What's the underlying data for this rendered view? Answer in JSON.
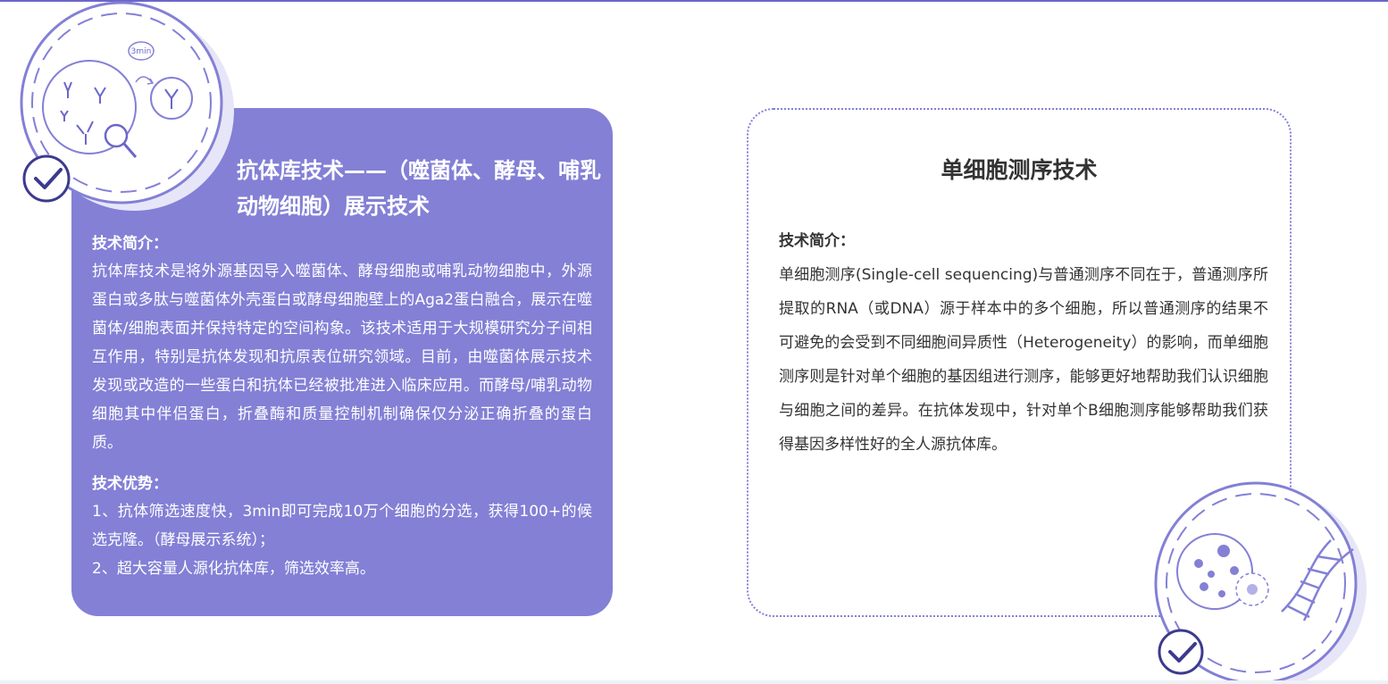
{
  "left_card": {
    "title": "抗体库技术——（噬菌体、酵母、哺乳动物细胞）展示技术",
    "intro_heading": "技术简介：",
    "intro_text": "抗体库技术是将外源基因导入噬菌体、酵母细胞或哺乳动物细胞中，外源蛋白或多肽与噬菌体外壳蛋白或酵母细胞壁上的Aga2蛋白融合，展示在噬菌体/细胞表面并保持特定的空间构象。该技术适用于大规模研究分子间相互作用，特别是抗体发现和抗原表位研究领域。目前，由噬菌体展示技术发现或改造的一些蛋白和抗体已经被批准进入临床应用。而酵母/哺乳动物细胞其中伴侣蛋白，折叠酶和质量控制机制确保仅分泌正确折叠的蛋白质。",
    "advantage_heading": "技术优势：",
    "advantage_1": "1、抗体筛选速度快，3min即可完成10万个细胞的分选，获得100+的候选克隆。（酵母展示系统）；",
    "advantage_2": "2、超大容量人源化抗体库，筛选效率高。",
    "icon_badge_text": "3min"
  },
  "right_card": {
    "title": "单细胞测序技术",
    "intro_heading": "技术简介：",
    "intro_text": "单细胞测序(Single-cell sequencing)与普通测序不同在于，普通测序所提取的RNA（或DNA）源于样本中的多个细胞，所以普通测序的结果不可避免的会受到不同细胞间异质性（Heterogeneity）的影响，而单细胞测序则是针对单个细胞的基因组进行测序，能够更好地帮助我们认识细胞与细胞之间的差异。在抗体发现中，针对单个B细胞测序能够帮助我们获得基因多样性好的全人源抗体库。"
  },
  "colors": {
    "accent": "#8380d6",
    "accent_dark": "#3c3a8e",
    "text_dark": "#333333",
    "halo": "#e7e6f8"
  }
}
